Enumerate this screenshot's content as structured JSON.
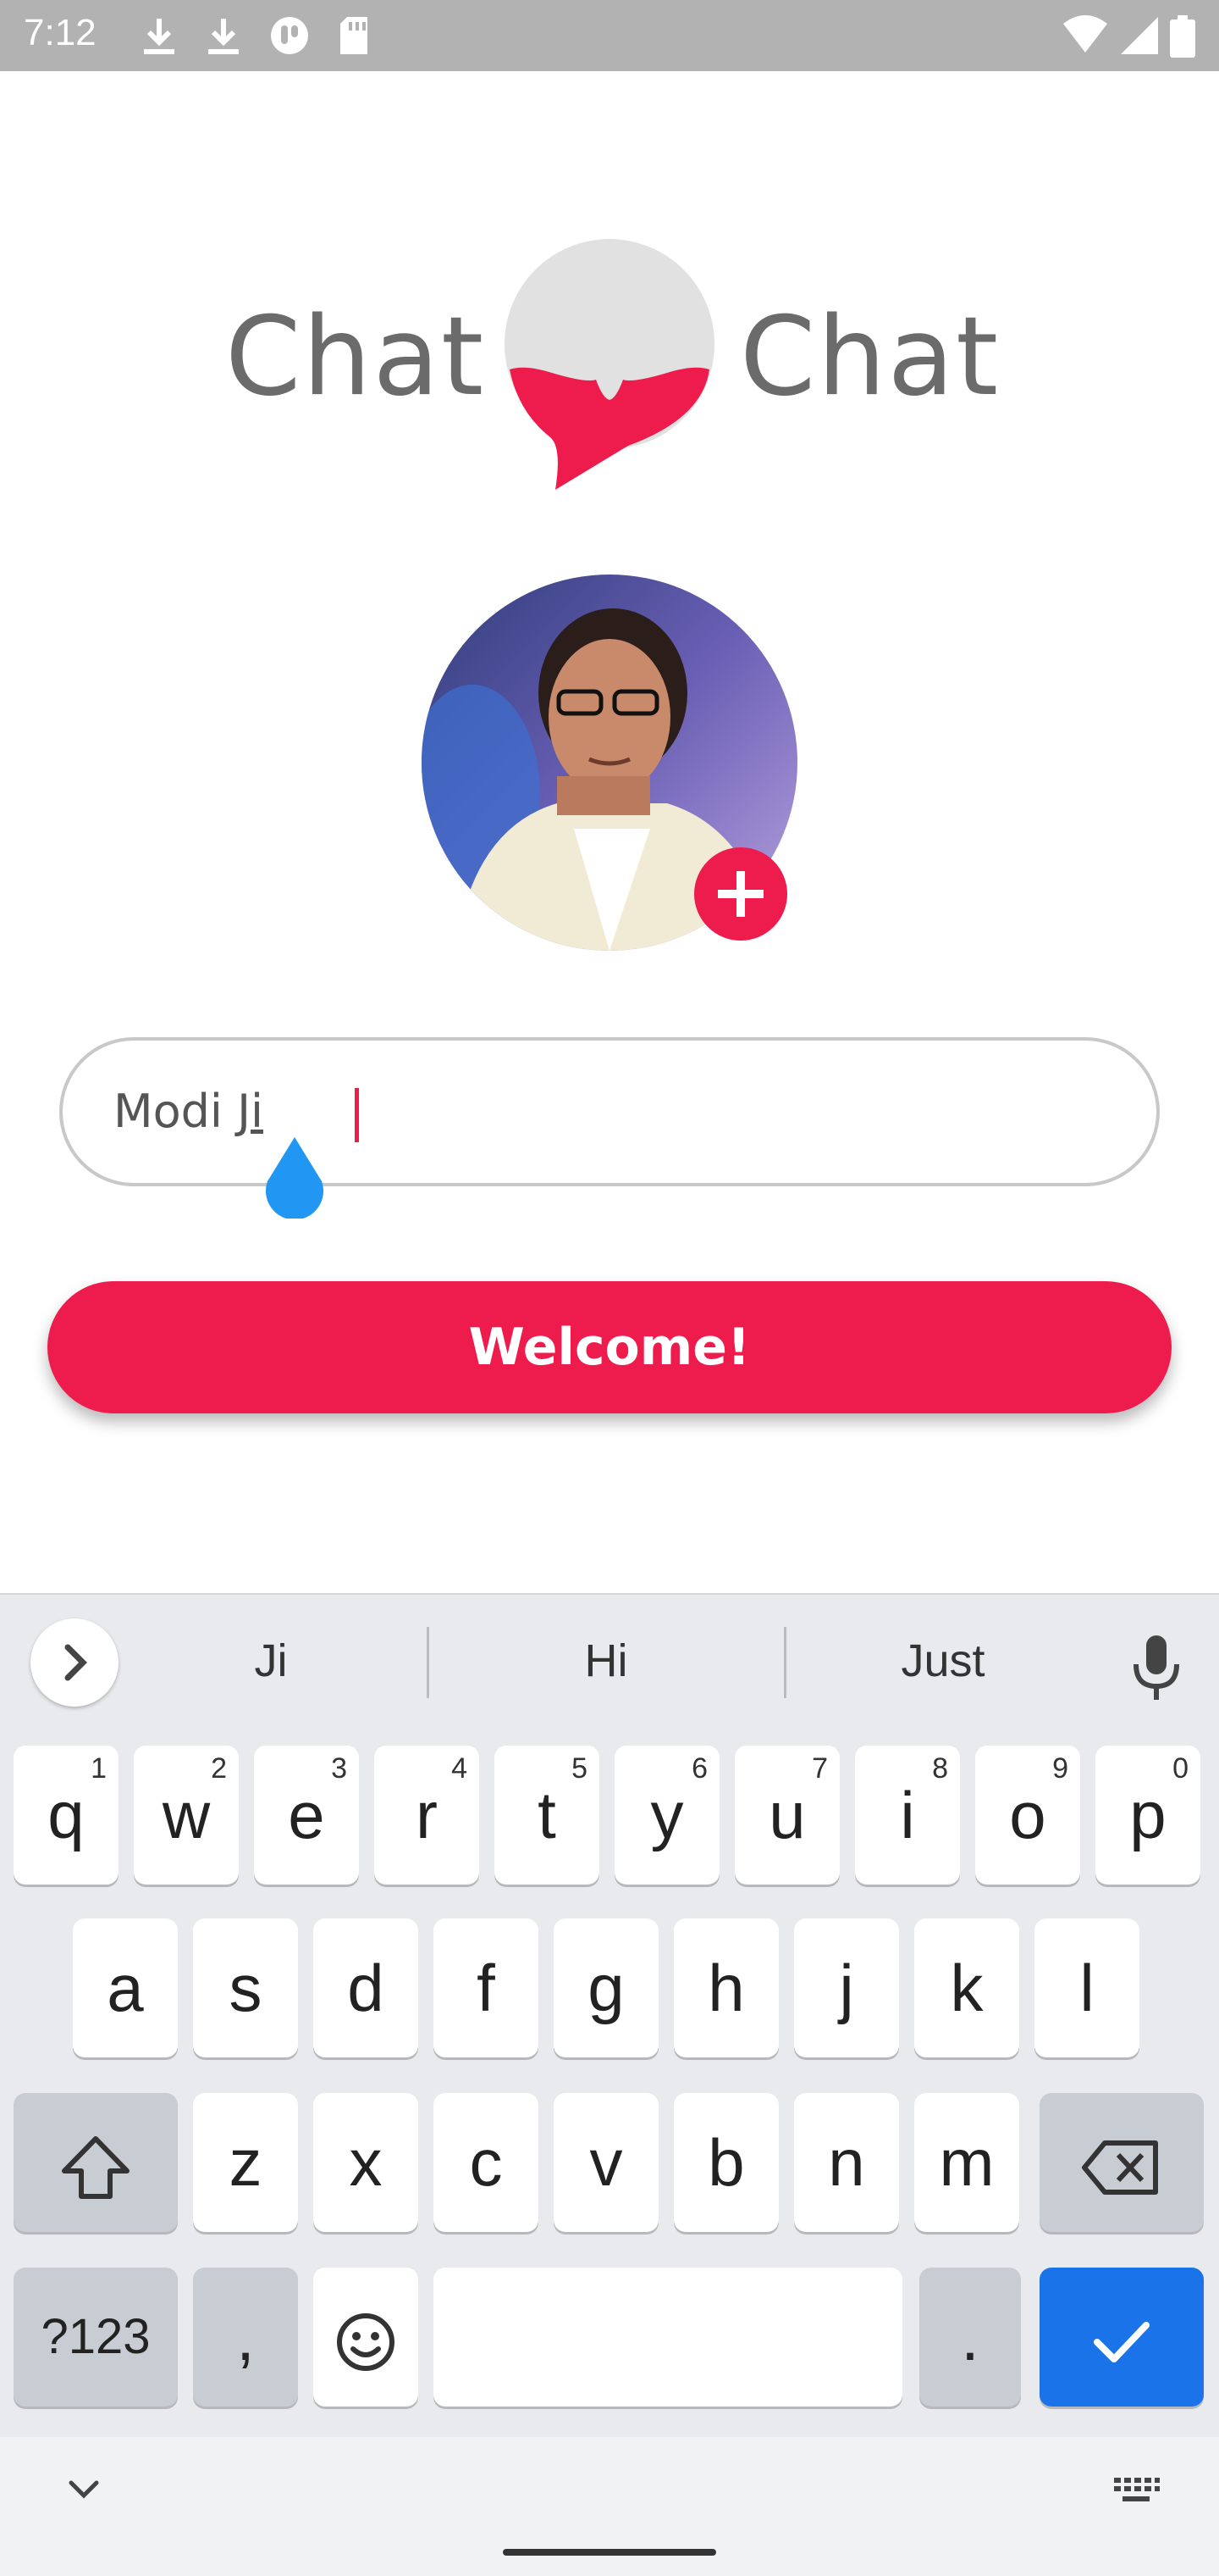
{
  "status_bar": {
    "time": "7:12"
  },
  "logo": {
    "left_word": "Chat",
    "right_word": "Chat"
  },
  "name_field": {
    "value_prefix": "Modi ",
    "value_composing": "Ji"
  },
  "welcome_button": {
    "label": "Welcome!"
  },
  "keyboard": {
    "suggestions": [
      "Ji",
      "Hi",
      "Just"
    ],
    "row1": [
      {
        "k": "q",
        "h": "1"
      },
      {
        "k": "w",
        "h": "2"
      },
      {
        "k": "e",
        "h": "3"
      },
      {
        "k": "r",
        "h": "4"
      },
      {
        "k": "t",
        "h": "5"
      },
      {
        "k": "y",
        "h": "6"
      },
      {
        "k": "u",
        "h": "7"
      },
      {
        "k": "i",
        "h": "8"
      },
      {
        "k": "o",
        "h": "9"
      },
      {
        "k": "p",
        "h": "0"
      }
    ],
    "row2": [
      "a",
      "s",
      "d",
      "f",
      "g",
      "h",
      "j",
      "k",
      "l"
    ],
    "row3": [
      "z",
      "x",
      "c",
      "v",
      "b",
      "n",
      "m"
    ],
    "symbols_label": "?123",
    "comma": ",",
    "period": "."
  },
  "colors": {
    "accent": "#ee1c4c",
    "keyboard_action": "#1a73e8",
    "logo_gray": "#6b6b6b"
  },
  "icons": [
    "download-icon",
    "download-icon",
    "app-icon",
    "sd-card-icon",
    "wifi-icon",
    "signal-icon",
    "battery-icon",
    "plus-icon",
    "chevron-right-icon",
    "mic-icon",
    "shift-icon",
    "backspace-icon",
    "emoji-icon",
    "check-icon",
    "chevron-down-icon",
    "keyboard-icon"
  ]
}
